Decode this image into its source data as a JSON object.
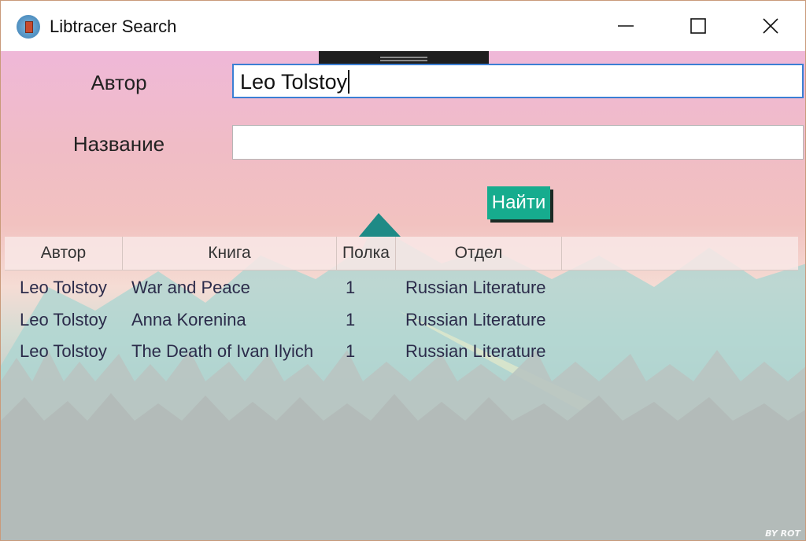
{
  "window": {
    "title": "Libtracer Search",
    "controls": {
      "minimize": "minimize",
      "maximize": "maximize",
      "close": "close"
    }
  },
  "form": {
    "author_label": "Автор",
    "author_value": "Leo Tolstoy",
    "title_label": "Название",
    "title_value": "",
    "search_button": "Найти"
  },
  "table": {
    "headers": [
      "Автор",
      "Книга",
      "Полка",
      "Отдел"
    ],
    "rows": [
      [
        "Leo Tolstoy",
        "War and Peace",
        "1",
        "Russian Literature"
      ],
      [
        "Leo Tolstoy",
        "Anna Korenina",
        "1",
        "Russian Literature"
      ],
      [
        "Leo Tolstoy",
        "The Death of Ivan Ilyich",
        "1",
        "Russian Literature"
      ]
    ]
  },
  "watermark": "BY ROT",
  "colors": {
    "accent": "#16ac8e",
    "input_focus_border": "#3b7fd4",
    "background_top": "#efb8d8"
  }
}
